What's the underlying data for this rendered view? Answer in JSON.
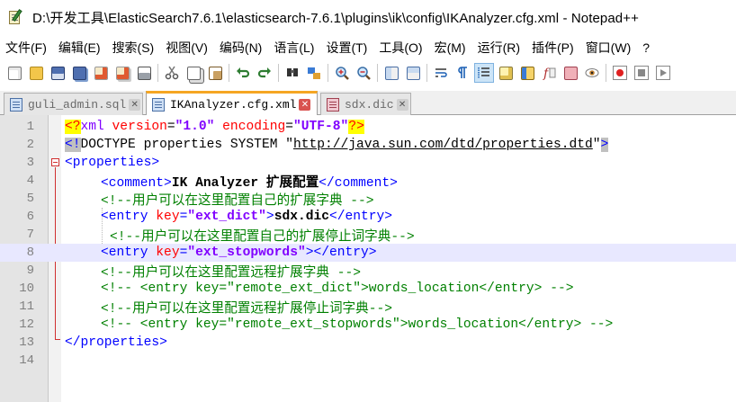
{
  "window": {
    "title": "D:\\开发工具\\ElasticSearch7.6.1\\elasticsearch-7.6.1\\plugins\\ik\\config\\IKAnalyzer.cfg.xml - Notepad++"
  },
  "menu": [
    {
      "id": "file",
      "label": "文件(F)"
    },
    {
      "id": "edit",
      "label": "编辑(E)"
    },
    {
      "id": "search",
      "label": "搜索(S)"
    },
    {
      "id": "view",
      "label": "视图(V)"
    },
    {
      "id": "encoding",
      "label": "编码(N)"
    },
    {
      "id": "language",
      "label": "语言(L)"
    },
    {
      "id": "settings",
      "label": "设置(T)"
    },
    {
      "id": "tools",
      "label": "工具(O)"
    },
    {
      "id": "macro",
      "label": "宏(M)"
    },
    {
      "id": "run",
      "label": "运行(R)"
    },
    {
      "id": "plugins",
      "label": "插件(P)"
    },
    {
      "id": "window",
      "label": "窗口(W)"
    },
    {
      "id": "help",
      "label": "?"
    }
  ],
  "toolbar": {
    "icons": [
      "new-file-icon",
      "open-file-icon",
      "save-icon",
      "save-all-icon",
      "close-icon",
      "close-all-icon",
      "print-icon",
      "cut-icon",
      "copy-icon",
      "paste-icon",
      "undo-icon",
      "redo-icon",
      "find-icon",
      "replace-icon",
      "zoom-in-icon",
      "zoom-out-icon",
      "sync-vertical-icon",
      "sync-horizontal-icon",
      "word-wrap-icon",
      "show-all-chars-icon",
      "indent-guide-icon",
      "language-icon",
      "doc-map-icon",
      "function-list-icon",
      "folder-workspace-icon",
      "monitoring-icon",
      "record-macro-icon",
      "stop-macro-icon",
      "play-macro-icon"
    ]
  },
  "tabs": [
    {
      "label": "guli_admin.sql",
      "active": false
    },
    {
      "label": "IKAnalyzer.cfg.xml",
      "active": true
    },
    {
      "label": "sdx.dic",
      "active": false
    }
  ],
  "tab_close_glyph": "✕",
  "editor": {
    "lines": [
      {
        "n": "1",
        "t1": "<?",
        "t2": "xml",
        "t3": " version",
        "t4": "=",
        "t5": "\"1.0\"",
        "t6": " encoding",
        "t7": "=",
        "t8": "\"UTF-8\"",
        "t9": "?>"
      },
      {
        "n": "2",
        "t1": "<!",
        "t2": "DOCTYPE properties SYSTEM \"",
        "t3": "http://java.sun.com/dtd/properties.dtd",
        "t4": "\"",
        "t5": ">"
      },
      {
        "n": "3",
        "t1": "<properties>"
      },
      {
        "n": "4",
        "t1": "<comment>",
        "t2": "IK Analyzer 扩展配置",
        "t3": "</comment>"
      },
      {
        "n": "5",
        "t1": "<!--用户可以在这里配置自己的扩展字典 -->"
      },
      {
        "n": "6",
        "t1": "<entry",
        "t2": " key",
        "t3": "=",
        "t4": "\"ext_dict\"",
        "t5": ">",
        "t6": "sdx.dic",
        "t7": "</entry>"
      },
      {
        "n": "7",
        "t1": "<!--用户可以在这里配置自己的扩展停止词字典-->"
      },
      {
        "n": "8",
        "t1": "<entry",
        "t2": " key",
        "t3": "=",
        "t4": "\"ext_stopwords\"",
        "t5": "></entry>"
      },
      {
        "n": "9",
        "t1": "<!--用户可以在这里配置远程扩展字典 -->"
      },
      {
        "n": "10",
        "t1": "<!-- <entry key=\"remote_ext_dict\">words_location</entry> -->"
      },
      {
        "n": "11",
        "t1": "<!--用户可以在这里配置远程扩展停止词字典-->"
      },
      {
        "n": "12",
        "t1": "<!-- <entry key=\"remote_ext_stopwords\">words_location</entry> -->"
      },
      {
        "n": "13",
        "t1": "</properties>"
      },
      {
        "n": "14"
      }
    ]
  }
}
